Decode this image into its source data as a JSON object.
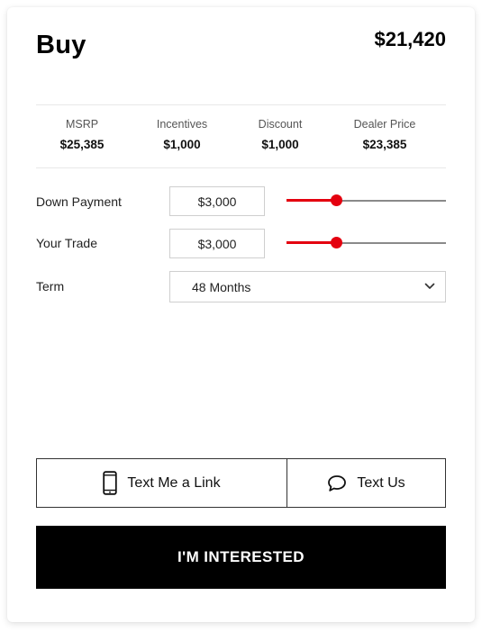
{
  "header": {
    "title": "Buy",
    "total": "$21,420"
  },
  "pricing": [
    {
      "label": "MSRP",
      "value": "$25,385"
    },
    {
      "label": "Incentives",
      "value": "$1,000"
    },
    {
      "label": "Discount",
      "value": "$1,000"
    },
    {
      "label": "Dealer Price",
      "value": "$23,385"
    }
  ],
  "down_payment": {
    "label": "Down Payment",
    "value": "$3,000",
    "slider_fraction": 0.31
  },
  "trade": {
    "label": "Your Trade",
    "value": "$3,000",
    "slider_fraction": 0.31
  },
  "term": {
    "label": "Term",
    "selected": "48 Months"
  },
  "actions": {
    "text_link": "Text Me a Link",
    "text_us": "Text Us",
    "cta": "I'M INTERESTED"
  },
  "icons": {
    "text_link_icon": "smartphone-icon",
    "text_us_icon": "chat-bubble-icon",
    "term_icon": "chevron-down-icon"
  },
  "colors": {
    "accent": "#e4000f",
    "cta_background": "#000000",
    "cta_text": "#ffffff"
  }
}
